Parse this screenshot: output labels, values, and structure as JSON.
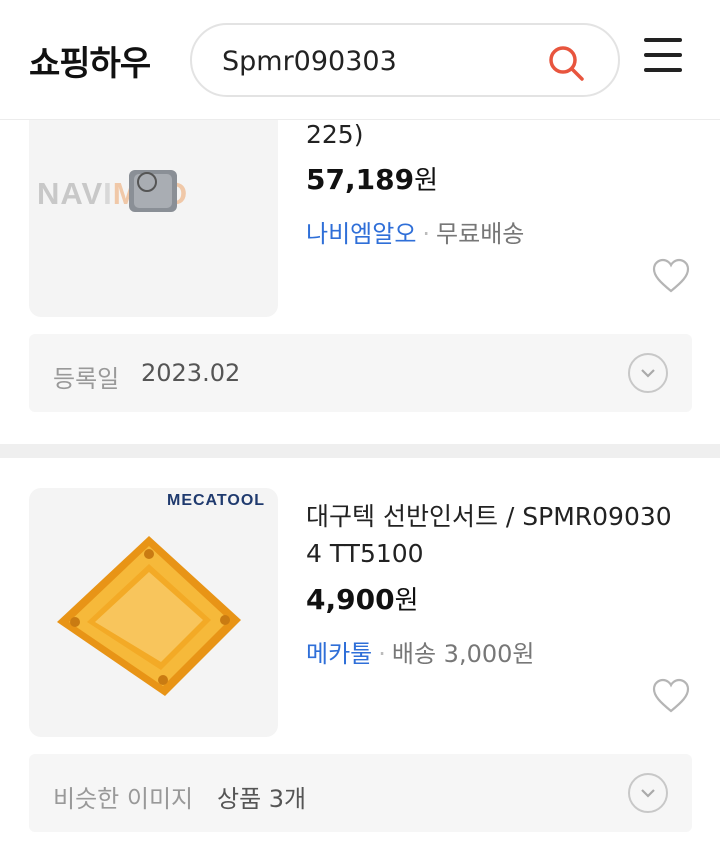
{
  "header": {
    "logo": "쇼핑하우",
    "search_value": "Spmr090303",
    "search_icon": "search-icon",
    "menu_icon": "hamburger-menu-icon"
  },
  "products": [
    {
      "title_tail": "225)",
      "price_number": "57,189",
      "price_unit": "원",
      "mall": "나비엠알오",
      "shipping": "무료배송",
      "thumb_brand": "NAVIMRO",
      "footer_label": "등록일",
      "footer_value": "2023.02"
    },
    {
      "title_line1": "대구텍 선반인서트 / SPMR09030",
      "title_line2": "4 TT5100",
      "price_number": "4,900",
      "price_unit": "원",
      "mall": "메카툴",
      "shipping": "배송 3,000원",
      "thumb_brand": "MECATOOL",
      "footer_label": "비슷한 이미지",
      "footer_value": "상품 3개"
    }
  ],
  "colors": {
    "mall_link": "#2f6fd8",
    "search_icon": "#e8553e",
    "insert_gold": "#f0a020"
  }
}
